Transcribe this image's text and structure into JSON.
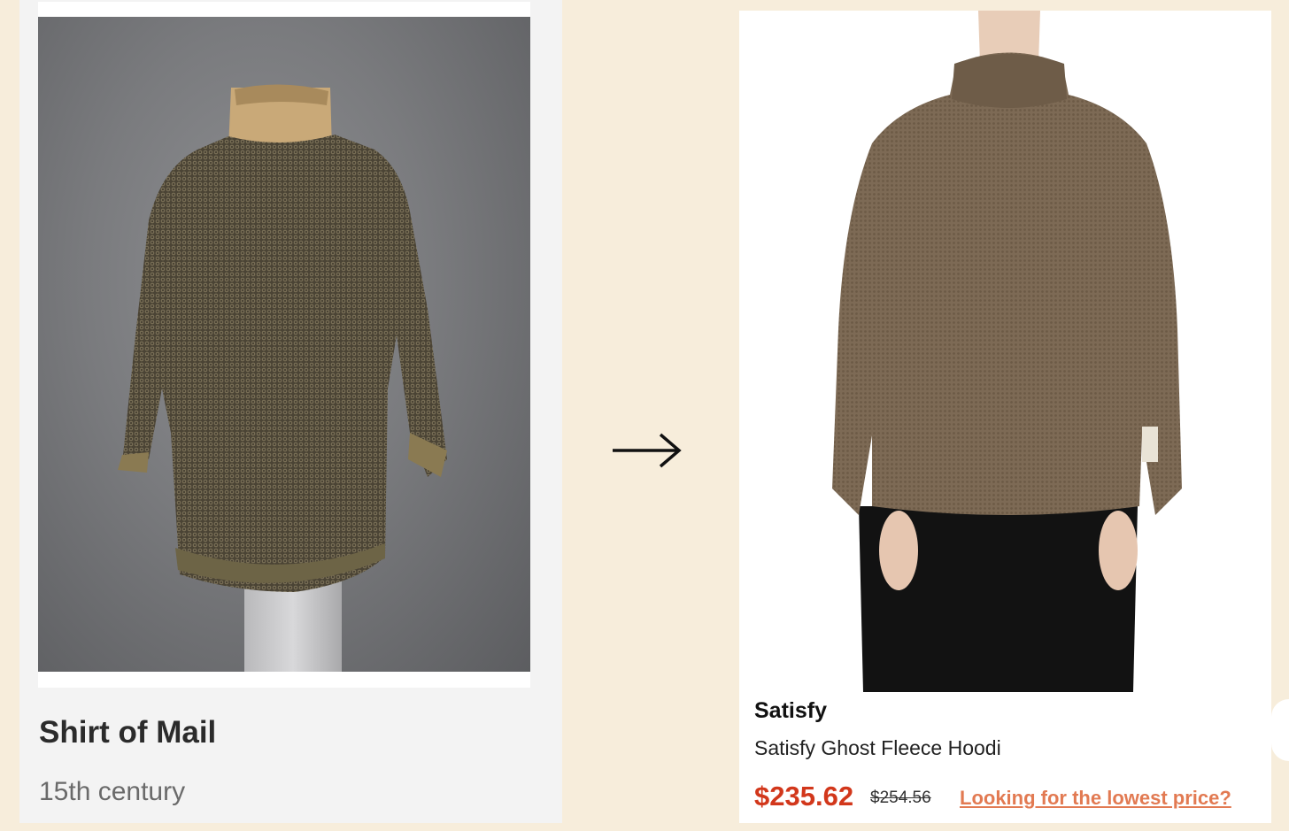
{
  "museum": {
    "title": "Shirt of Mail",
    "date": "15th century"
  },
  "shop": {
    "brand": "Satisfy",
    "product_name": "Satisfy Ghost Fleece Hoodi",
    "price": "$235.62",
    "original_price": "$254.56",
    "lowest_price_link": "Looking for the lowest price?"
  },
  "colors": {
    "page_background": "#f7eddb",
    "price_red": "#d2371b",
    "link_orange": "#e27a52",
    "mail_shirt": "#4f4738",
    "hoodie": "#7d6a55"
  },
  "icons": {
    "arrow": "right-arrow-icon"
  }
}
